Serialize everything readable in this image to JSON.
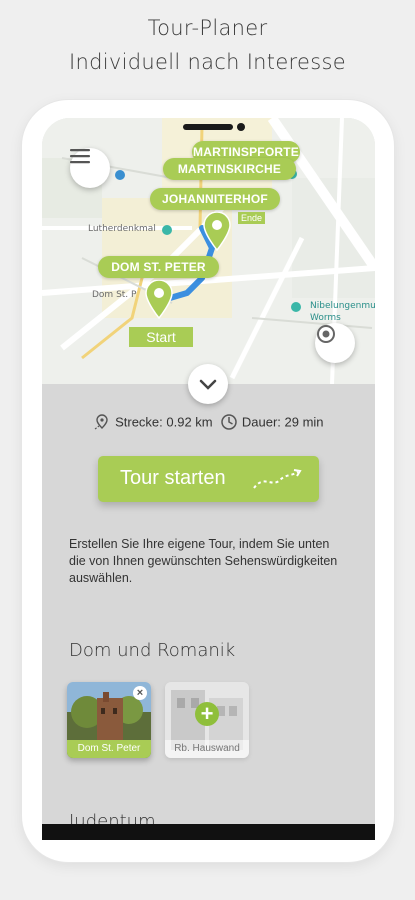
{
  "header": {
    "line1": "Tour-Planer",
    "line2": "Individuell nach Interesse"
  },
  "map": {
    "markers": {
      "martinspforte": "MARTINSPFORTE",
      "martinskirche": "MARTINSKIRCHE",
      "johanniterhof": "JOHANNITERHOF",
      "dom": "DOM ST. PETER",
      "start": "Start",
      "ende": "Ende"
    },
    "labels": {
      "lutherdenkmal": "Lutherdenkmal",
      "dom_street": "Dom St. P",
      "nibelungen": "Nibelungenmu",
      "worms": "Worms"
    }
  },
  "stats": {
    "distance": "Strecke: 0.92 km",
    "duration": "Dauer: 29 min"
  },
  "tour_button": {
    "label": "Tour starten"
  },
  "description": "Erstellen Sie Ihre eigene Tour, indem Sie unten die von Ihnen gewünschten Sehenswürdigkeiten auswählen.",
  "sections": [
    {
      "title": "Dom und Romanik",
      "cards": [
        {
          "label": "Dom St. Peter",
          "selected": true
        },
        {
          "label": "Rb. Hauswand",
          "selected": false
        }
      ]
    },
    {
      "title": "Judentum"
    }
  ],
  "colors": {
    "accent": "#a9cc55",
    "route": "#3b8fe0",
    "screen_bg": "#d7d7d7"
  },
  "icons": {
    "menu": "hamburger-icon",
    "locate": "target-icon",
    "collapse": "chevron-down-icon",
    "distance": "route-pin-icon",
    "duration": "clock-icon",
    "tour": "dotted-path-arrow-icon"
  }
}
